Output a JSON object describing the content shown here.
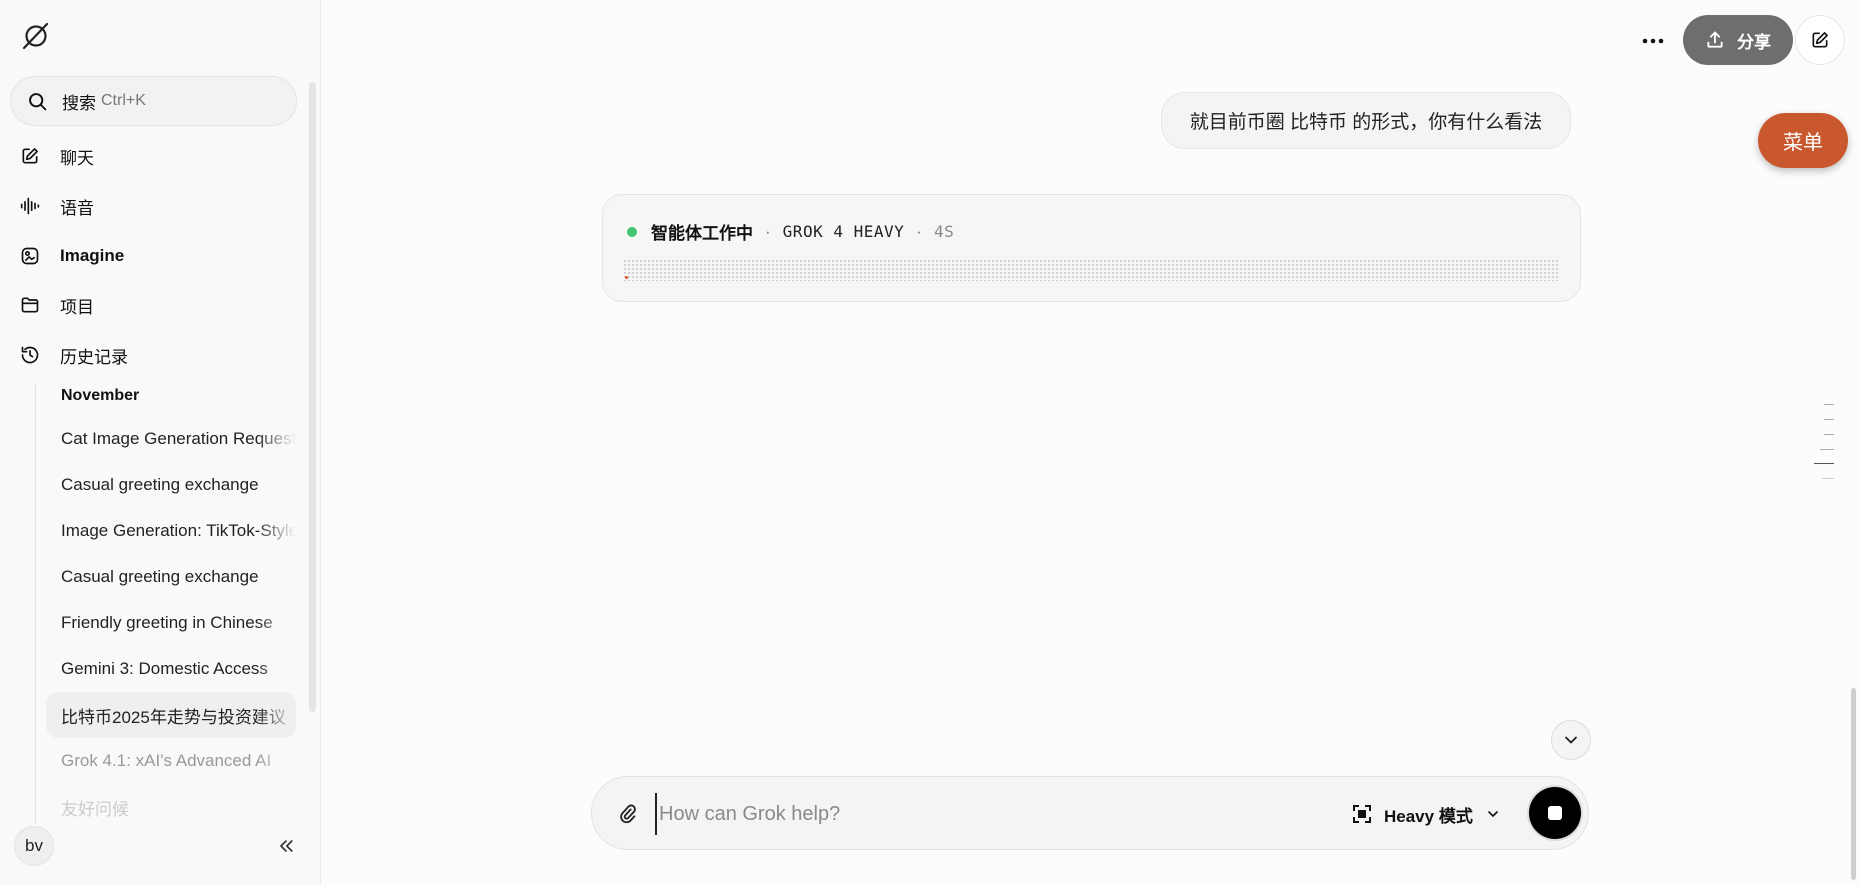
{
  "sidebar": {
    "search": {
      "label": "搜索",
      "shortcut": "Ctrl+K"
    },
    "nav": [
      {
        "label": "聊天",
        "icon": "edit-icon"
      },
      {
        "label": "语音",
        "icon": "voice-icon"
      },
      {
        "label": "Imagine",
        "icon": "imagine-icon"
      },
      {
        "label": "项目",
        "icon": "folder-icon"
      },
      {
        "label": "历史记录",
        "icon": "history-icon"
      }
    ],
    "history": {
      "heading": "November",
      "items": [
        "Cat Image Generation Request",
        "Casual greeting exchange",
        "Image Generation: TikTok-Style",
        "Casual greeting exchange",
        "Friendly greeting in Chinese",
        "Gemini 3: Domestic Access",
        "比特币2025年走势与投资建议",
        "Grok 4.1: xAI's Advanced AI",
        "友好问候"
      ]
    },
    "user_initials": "bv"
  },
  "topbar": {
    "share_label": "分享",
    "menu_label": "菜单"
  },
  "chat": {
    "user_message": "就目前币圈 比特币 的形式，你有什么看法",
    "agent": {
      "status": "智能体工作中",
      "model": "GROK 4 HEAVY",
      "elapsed": "4S",
      "status_color": "#41c46b"
    }
  },
  "composer": {
    "placeholder": "How can Grok help?",
    "mode_label": "Heavy 模式"
  },
  "colors": {
    "accent_menu": "#c9582e",
    "share_button": "#6e6e6e"
  }
}
